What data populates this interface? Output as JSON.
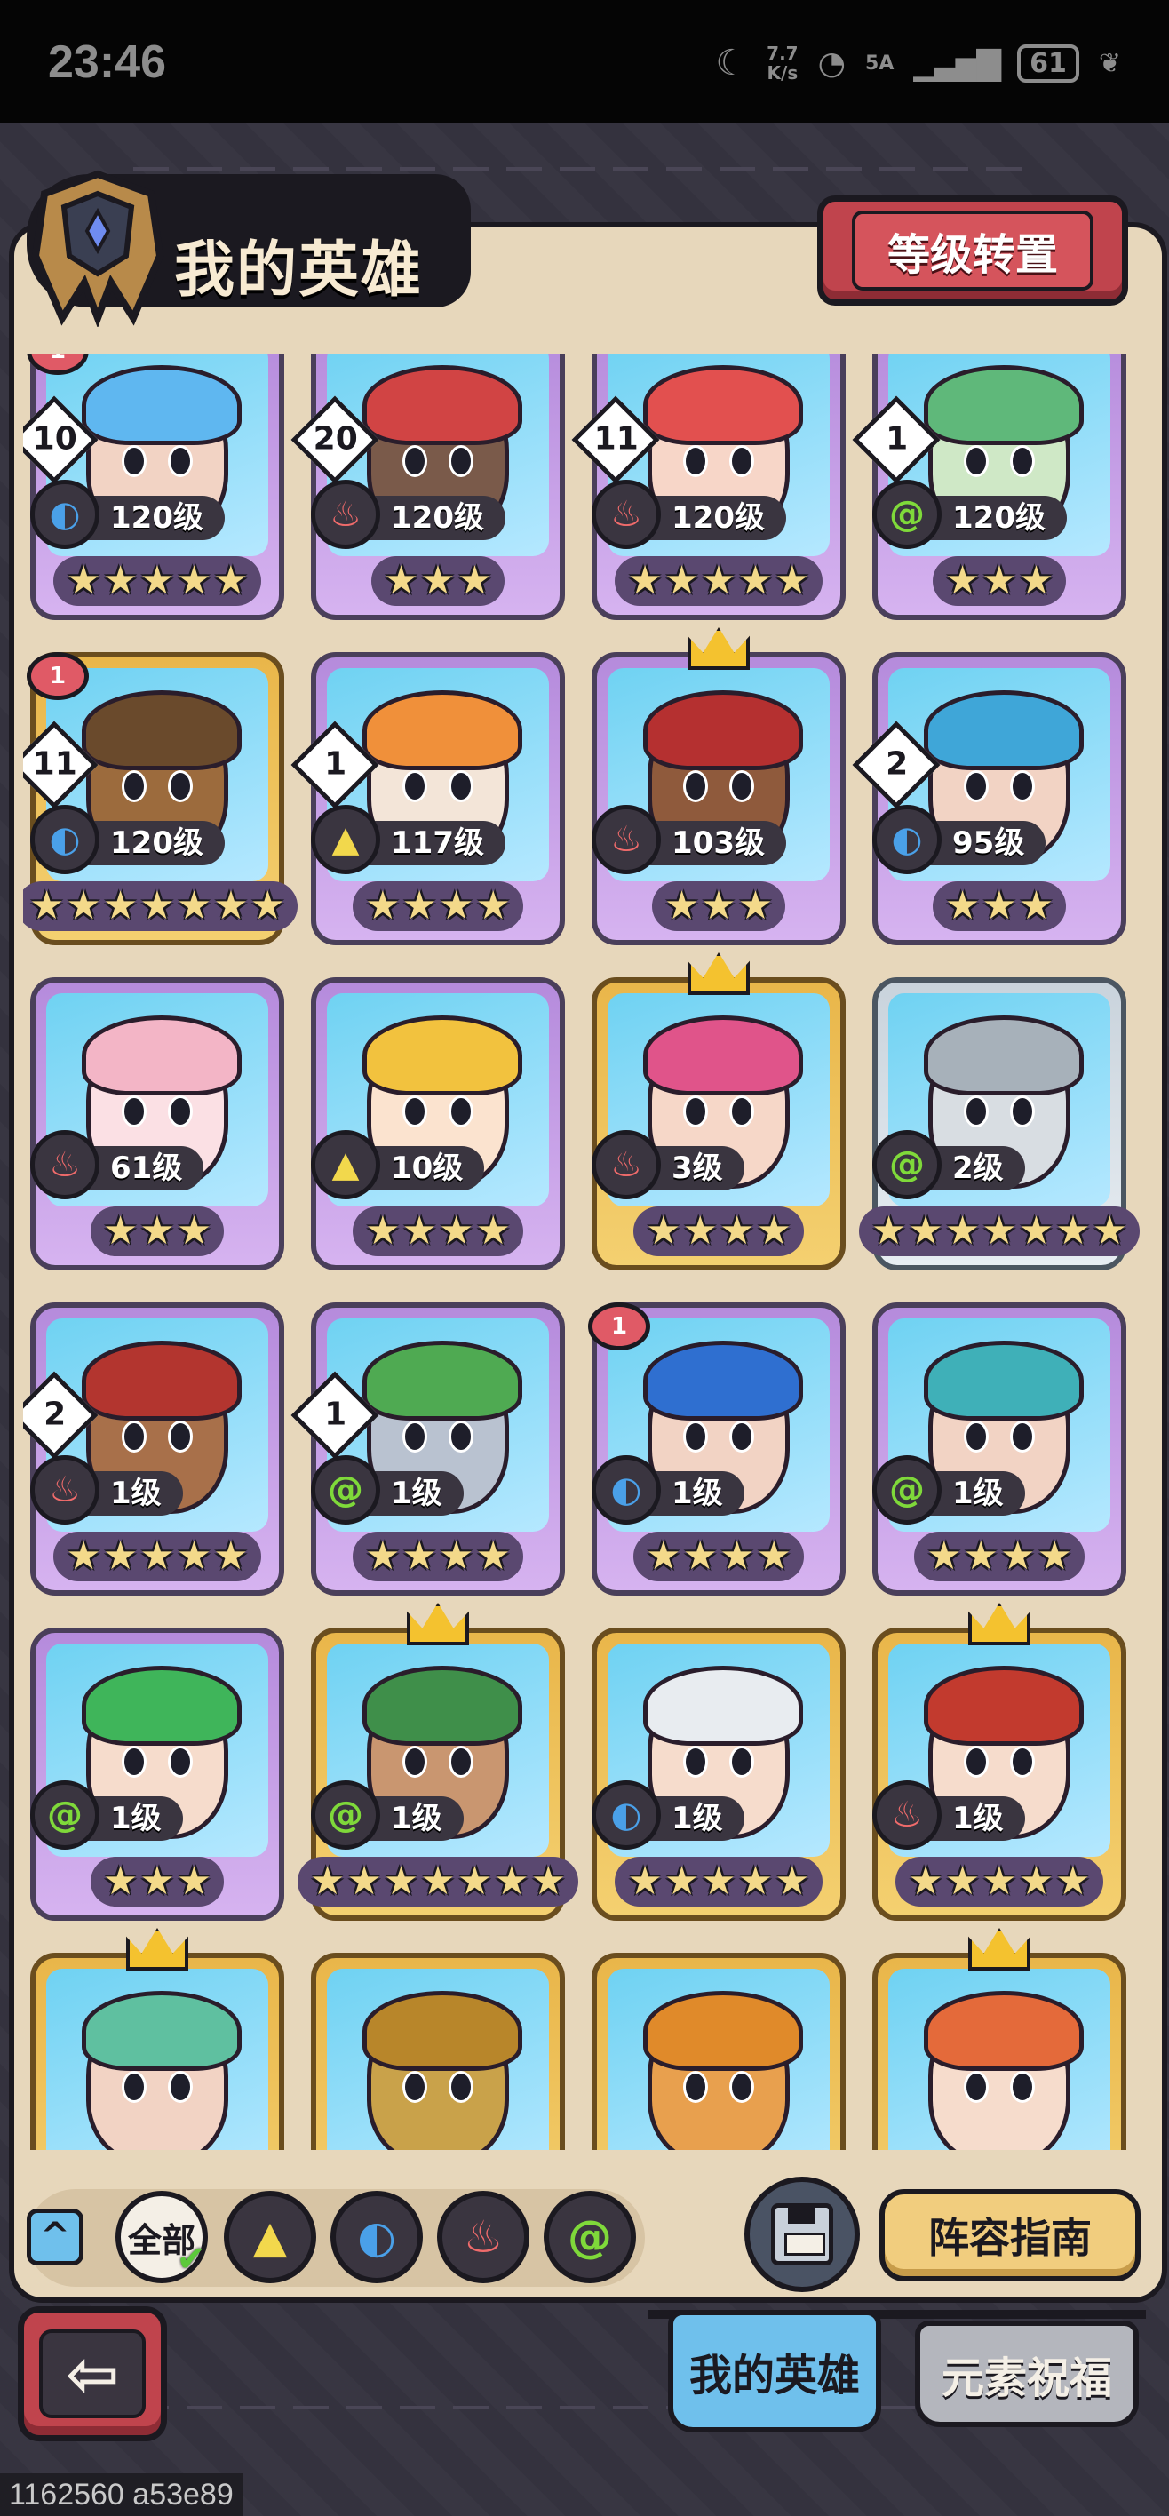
{
  "status_bar": {
    "time": "23:46",
    "net_speed_value": "7.7",
    "net_speed_unit": "K/s",
    "signal_label": "5A",
    "battery": "61"
  },
  "header": {
    "title": "我的英雄",
    "level_transfer_button": "等级转置"
  },
  "colors": {
    "water": "#4aa0e8",
    "fire": "#f06b6b",
    "wind": "#7fd93a",
    "earth": "#f2d84c",
    "red_button": "#c0444d",
    "blue_tab": "#6fc0ec"
  },
  "heroes": [
    {
      "level": "120级",
      "element": "water",
      "stars": 5,
      "rank": "10",
      "badge": "1",
      "crown": false,
      "frame": "purple",
      "skin": "#f2d3c4",
      "hair": "#5fb7f0"
    },
    {
      "level": "120级",
      "element": "fire",
      "stars": 3,
      "rank": "20",
      "badge": "",
      "crown": true,
      "frame": "purple",
      "skin": "#7a5a4a",
      "hair": "#d14444"
    },
    {
      "level": "120级",
      "element": "fire",
      "stars": 5,
      "rank": "11",
      "badge": "",
      "crown": false,
      "frame": "purple",
      "skin": "#f7d6c8",
      "hair": "#e2504f"
    },
    {
      "level": "120级",
      "element": "wind",
      "stars": 3,
      "rank": "1",
      "badge": "",
      "crown": false,
      "frame": "purple",
      "skin": "#cfe8c6",
      "hair": "#5fb87a"
    },
    {
      "level": "120级",
      "element": "water",
      "stars": 7,
      "rank": "11",
      "badge": "1",
      "crown": false,
      "frame": "gold",
      "skin": "#9c6b3d",
      "hair": "#6a4a2c"
    },
    {
      "level": "117级",
      "element": "earth",
      "stars": 4,
      "rank": "1",
      "badge": "",
      "crown": false,
      "frame": "purple",
      "skin": "#f3e5d8",
      "hair": "#f0903a"
    },
    {
      "level": "103级",
      "element": "fire",
      "stars": 3,
      "rank": "",
      "badge": "",
      "crown": true,
      "frame": "purple",
      "skin": "#8f5a3c",
      "hair": "#b53030"
    },
    {
      "level": "95级",
      "element": "water",
      "stars": 3,
      "rank": "2",
      "badge": "",
      "crown": false,
      "frame": "purple",
      "skin": "#f2d3c4",
      "hair": "#3fa6d8"
    },
    {
      "level": "61级",
      "element": "fire",
      "stars": 3,
      "rank": "",
      "badge": "",
      "crown": false,
      "frame": "purple",
      "skin": "#fbe0e4",
      "hair": "#f3b5c6"
    },
    {
      "level": "10级",
      "element": "earth",
      "stars": 4,
      "rank": "",
      "badge": "",
      "crown": false,
      "frame": "purple",
      "skin": "#fbe3cf",
      "hair": "#f2c23e"
    },
    {
      "level": "3级",
      "element": "fire",
      "stars": 4,
      "rank": "",
      "badge": "",
      "crown": true,
      "frame": "gold",
      "skin": "#f6d7c8",
      "hair": "#e0548a"
    },
    {
      "level": "2级",
      "element": "wind",
      "stars": 7,
      "rank": "",
      "badge": "",
      "crown": false,
      "frame": "silver",
      "skin": "#d8dde2",
      "hair": "#a7b1ba"
    },
    {
      "level": "1级",
      "element": "fire",
      "stars": 5,
      "rank": "2",
      "badge": "",
      "crown": false,
      "frame": "purple",
      "skin": "#a8704a",
      "hair": "#b3352f"
    },
    {
      "level": "1级",
      "element": "wind",
      "stars": 4,
      "rank": "1",
      "badge": "",
      "crown": false,
      "frame": "purple",
      "skin": "#b9c2d0",
      "hair": "#4faa52"
    },
    {
      "level": "1级",
      "element": "water",
      "stars": 4,
      "rank": "",
      "badge": "1",
      "crown": false,
      "frame": "purple",
      "skin": "#f2d3c4",
      "hair": "#2f6fd0"
    },
    {
      "level": "1级",
      "element": "wind",
      "stars": 4,
      "rank": "",
      "badge": "",
      "crown": false,
      "frame": "purple",
      "skin": "#f2d3c4",
      "hair": "#3fb0b8"
    },
    {
      "level": "1级",
      "element": "wind",
      "stars": 3,
      "rank": "",
      "badge": "",
      "crown": false,
      "frame": "purple",
      "skin": "#f6dccc",
      "hair": "#3fb55a"
    },
    {
      "level": "1级",
      "element": "wind",
      "stars": 7,
      "rank": "",
      "badge": "",
      "crown": true,
      "frame": "gold",
      "skin": "#c99670",
      "hair": "#3f8f4a"
    },
    {
      "level": "1级",
      "element": "water",
      "stars": 5,
      "rank": "",
      "badge": "",
      "crown": false,
      "frame": "gold",
      "skin": "#f6dccc",
      "hair": "#e8ecf0"
    },
    {
      "level": "1级",
      "element": "fire",
      "stars": 5,
      "rank": "",
      "badge": "",
      "crown": true,
      "frame": "gold",
      "skin": "#f6dccc",
      "hair": "#c23a2e"
    },
    {
      "level": "",
      "element": "",
      "stars": 0,
      "rank": "",
      "badge": "",
      "crown": true,
      "frame": "gold",
      "skin": "#f2d3c4",
      "hair": "#5fc0a0"
    },
    {
      "level": "",
      "element": "",
      "stars": 0,
      "rank": "",
      "badge": "",
      "crown": false,
      "frame": "gold",
      "skin": "#c9a24a",
      "hair": "#b8862a"
    },
    {
      "level": "",
      "element": "",
      "stars": 0,
      "rank": "",
      "badge": "",
      "crown": false,
      "frame": "gold",
      "skin": "#e8a04e",
      "hair": "#e08a2a"
    },
    {
      "level": "",
      "element": "",
      "stars": 0,
      "rank": "",
      "badge": "",
      "crown": true,
      "frame": "gold",
      "skin": "#f6dccc",
      "hair": "#e46a3a"
    }
  ],
  "filters": {
    "all_label": "全部",
    "items": [
      "earth",
      "water",
      "fire",
      "wind"
    ]
  },
  "actions": {
    "formation_guide": "阵容指南"
  },
  "tabs": {
    "my_heroes": "我的英雄",
    "element_blessing": "元素祝福"
  },
  "build_tag": "1162560 a53e89"
}
